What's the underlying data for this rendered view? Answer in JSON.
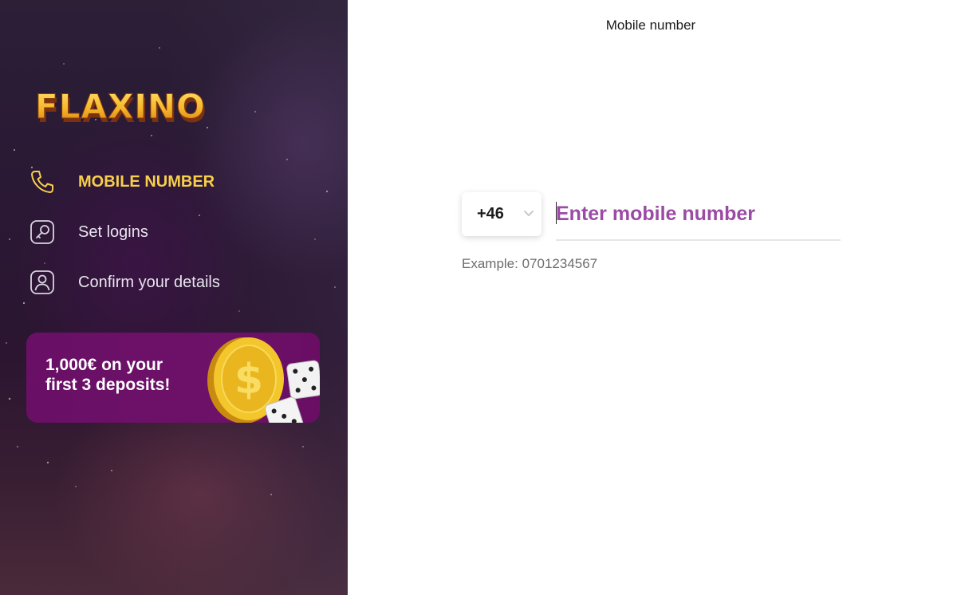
{
  "brand": {
    "logo_text": "FLAXINO"
  },
  "sidebar": {
    "steps": [
      {
        "label": "MOBILE NUMBER",
        "icon": "phone-icon",
        "active": true
      },
      {
        "label": "Set logins",
        "icon": "key-icon",
        "active": false
      },
      {
        "label": "Confirm your details",
        "icon": "user-icon",
        "active": false
      }
    ]
  },
  "promo": {
    "line1": "1,000€ on your",
    "line2": "first 3 deposits!"
  },
  "form": {
    "title": "Mobile number",
    "country_code": "+46",
    "phone_placeholder": "Enter mobile number",
    "phone_value": "",
    "example": "Example: 0701234567"
  },
  "colors": {
    "accent_yellow": "#f7cf4a",
    "placeholder_purple": "#9b4aa5",
    "promo_bg": "#6d1169"
  }
}
